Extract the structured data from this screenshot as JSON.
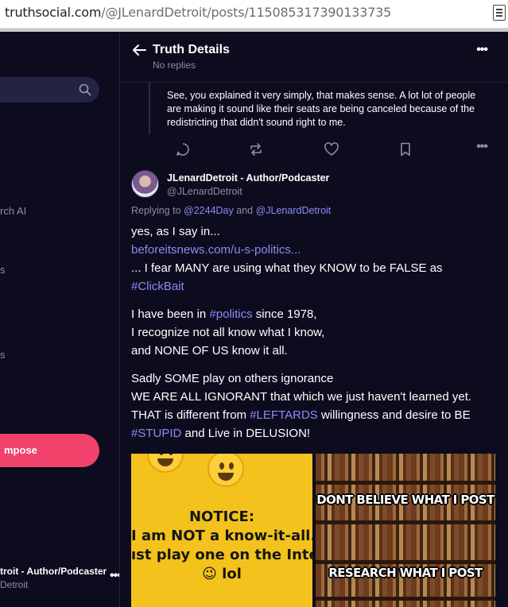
{
  "browser": {
    "url_domain": "truthsocial.com",
    "url_path": "/@JLenardDetroit/posts/115085317390133735"
  },
  "sidebar": {
    "search_icon": "search-icon",
    "partial_labels": [
      "rch AI",
      "s",
      "s"
    ],
    "compose_label": "mpose",
    "account_name": "troit - Author/Podcaster",
    "account_handle": "Detroit",
    "more": "•••"
  },
  "header": {
    "title": "Truth Details",
    "subtitle": "No replies",
    "more": "•••"
  },
  "previous_post": {
    "text": "See, you explained it very simply, that makes sense. A lot lot of people are making it sound like their seats are being canceled because of the redistricting that didn't sound right to me."
  },
  "actions": {
    "icons": [
      "reply-icon",
      "retruth-icon",
      "like-icon",
      "bookmark-icon"
    ],
    "more": "•••"
  },
  "post": {
    "author_name": "JLenardDetroit - Author/Podcaster",
    "author_handle": "@JLenardDetroit",
    "replying_prefix": "Replying to",
    "replying_user1": "@2244Day",
    "replying_and": "and",
    "replying_user2": "@JLenardDetroit",
    "p1_line1": "yes, as I say in...",
    "p1_link": "beforeitsnews.com/u-s-politics...",
    "p1_line3": "... I fear MANY are using what they KNOW to be FALSE as",
    "p1_hashtag": "#ClickBait",
    "p2_pre": "I have been in",
    "p2_hashtag": "#politics",
    "p2_post": "since 1978,",
    "p2_line2": "I recognize not all know what I know,",
    "p2_line3": "and NONE OF US know it all.",
    "p3_line1": "Sadly SOME play on others ignorance",
    "p3_line2": "WE ARE ALL IGNORANT that which we just haven't learned yet.",
    "p3_line3_pre": "THAT is different from",
    "p3_hashtag1": "#LEFTARDS",
    "p3_line3_post": "willingness and desire to BE",
    "p3_hashtag2": "#STUPID",
    "p3_line4_post": "and Live in DELUSION!"
  },
  "images": {
    "left": {
      "line1": "NOTICE:",
      "line2": "I am NOT a know-it-all...",
      "line3": "ıst play one on the Intern",
      "line4": "😉 lol"
    },
    "right": {
      "top": "DONT BELIEVE WHAT I POST",
      "bottom": "RESEARCH WHAT I POST"
    }
  },
  "colors": {
    "background": "#0d0b1e",
    "link": "#8a8cf5",
    "compose": "#f0426a",
    "muted": "#8e8ba6"
  }
}
